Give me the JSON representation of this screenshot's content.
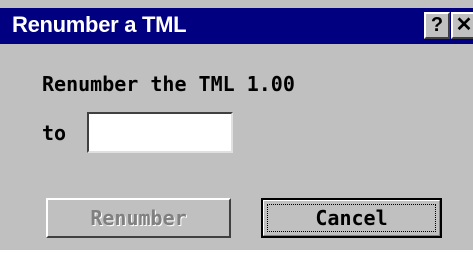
{
  "window": {
    "title": "Renumber a TML",
    "help_button": "?",
    "close_button": "✕"
  },
  "content": {
    "prompt": "Renumber the TML 1.00",
    "to_label": "to",
    "to_value": ""
  },
  "buttons": {
    "renumber": "Renumber",
    "renumber_enabled": false,
    "cancel": "Cancel"
  },
  "colors": {
    "titlebar": "#000080",
    "face": "#c0c0c0",
    "disabled_text": "#808080"
  },
  "icons": {
    "help": "help-icon",
    "close": "close-icon"
  }
}
